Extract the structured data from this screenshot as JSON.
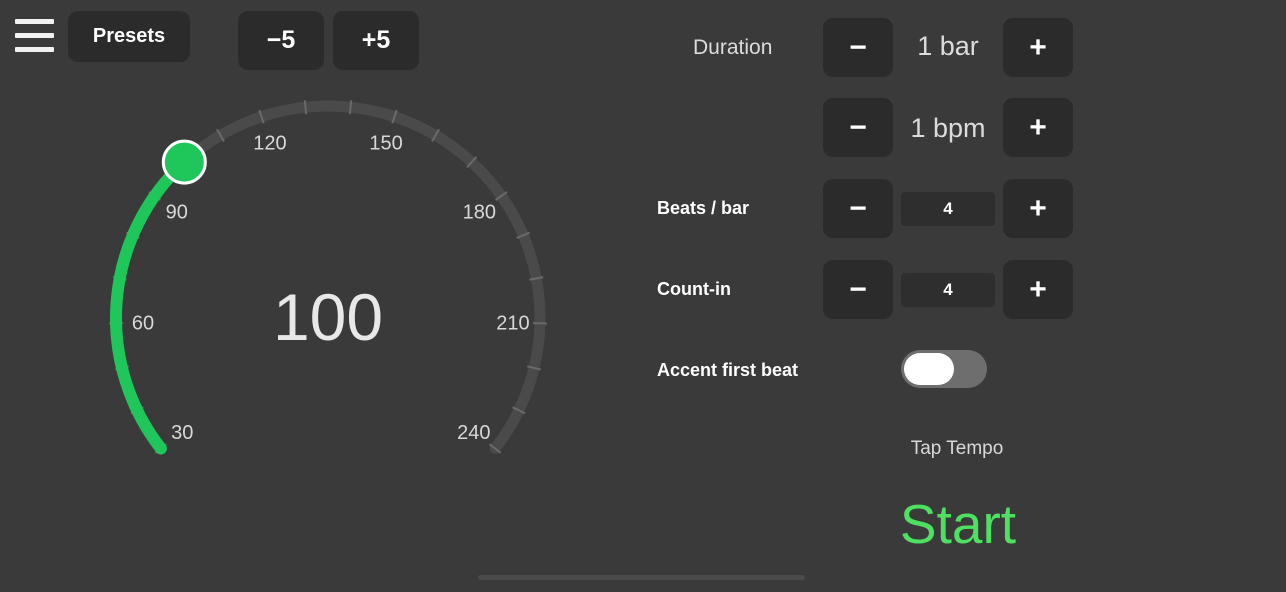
{
  "toolbar": {
    "presets_label": "Presets",
    "minus5_label": "−5",
    "plus5_label": "+5"
  },
  "dial": {
    "value": "100",
    "bpm": 100,
    "min": 30,
    "max": 240,
    "tick_labels": [
      "30",
      "60",
      "90",
      "120",
      "150",
      "180",
      "210",
      "240"
    ],
    "active_color": "#1fc65a",
    "track_color": "#4a4a4a"
  },
  "settings": {
    "duration": {
      "label": "Duration",
      "value": "1 bar",
      "minus": "−",
      "plus": "+"
    },
    "increment": {
      "value": "1 bpm",
      "minus": "−",
      "plus": "+"
    },
    "beats_per_bar": {
      "label": "Beats / bar",
      "value": "4",
      "minus": "−",
      "plus": "+"
    },
    "count_in": {
      "label": "Count-in",
      "value": "4",
      "minus": "−",
      "plus": "+"
    },
    "accent_first_beat": {
      "label": "Accent first beat",
      "enabled": false
    }
  },
  "actions": {
    "tap_tempo": "Tap Tempo",
    "start": "Start",
    "start_color": "#4ee060"
  }
}
